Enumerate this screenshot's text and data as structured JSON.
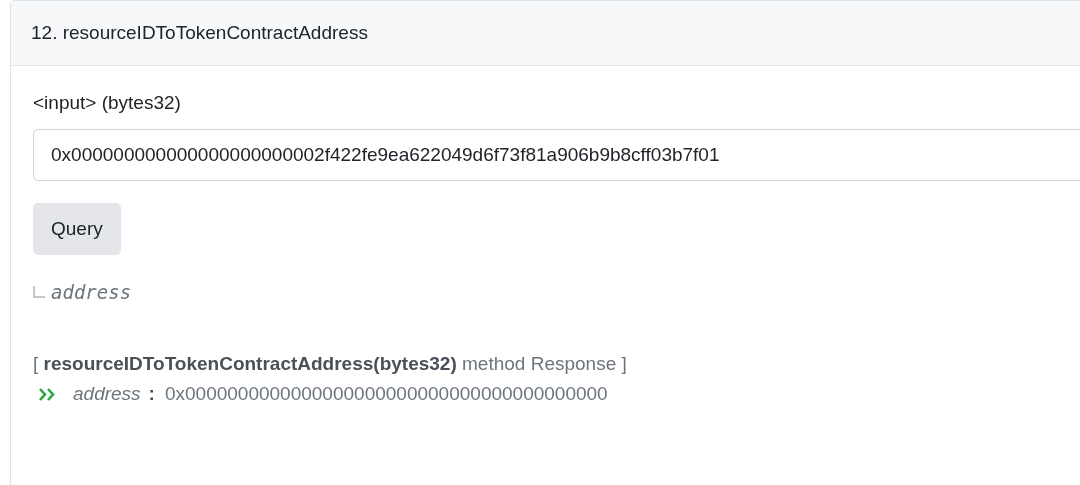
{
  "card": {
    "title": "12. resourceIDToTokenContractAddress",
    "input_label": "<input> (bytes32)",
    "input": {
      "value": "0x000000000000000000000002f422fe9ea622049d6f73f81a906b9b8cff03b7f01"
    },
    "query_button": "Query",
    "output_name": "address",
    "response": {
      "heading": "[ **resourceIDToTokenContractAddress(bytes32)** method Response ]",
      "rows": [
        {
          "name": "address",
          "separator": ":",
          "value": "0x0000000000000000000000000000000000000000"
        }
      ]
    }
  }
}
